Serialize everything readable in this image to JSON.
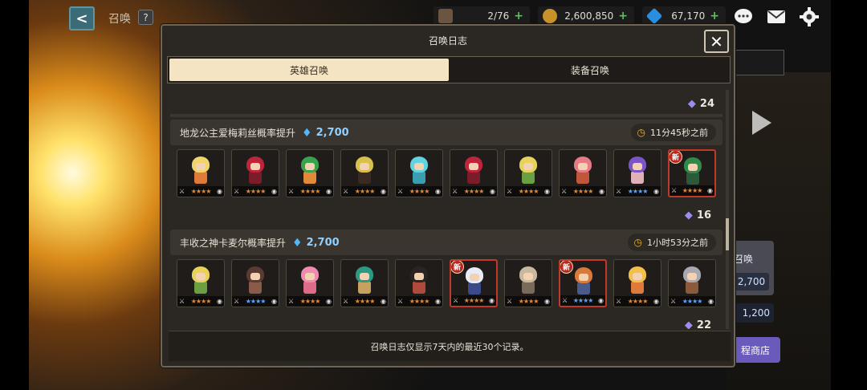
{
  "topbar": {
    "back_label": "<",
    "title": "召唤",
    "help_label": "?",
    "stamina": "2/76",
    "gold": "2,600,850",
    "gems": "67,170",
    "plus": "+"
  },
  "dialog": {
    "title": "召唤日志",
    "close_label": "✕",
    "tabs": [
      {
        "label": "英雄召唤",
        "active": true
      },
      {
        "label": "装备召唤",
        "active": false
      }
    ],
    "footer": "召唤日志仅显示7天内的最近30个记录。"
  },
  "log": {
    "top_count": "24",
    "entries": [
      {
        "title": "地龙公主爱梅莉丝概率提升",
        "cost": "2,700",
        "time": "11分45秒之前",
        "count": "16",
        "heroes": [
          {
            "hair": "#f2d56a",
            "body": "#e07a3a",
            "new": false,
            "stars": "★★★★",
            "blue": false
          },
          {
            "hair": "#c0243a",
            "body": "#7a1c2a",
            "new": false,
            "stars": "★★★★",
            "blue": false
          },
          {
            "hair": "#3aa24a",
            "body": "#e08a3a",
            "new": false,
            "stars": "★★★★",
            "blue": false
          },
          {
            "hair": "#d8c14a",
            "body": "#3b2a22",
            "new": false,
            "stars": "★★★★",
            "blue": false
          },
          {
            "hair": "#5fd3e0",
            "body": "#3a9eb0",
            "new": false,
            "stars": "★★★★",
            "blue": false
          },
          {
            "hair": "#c0243a",
            "body": "#7a1c2a",
            "new": false,
            "stars": "★★★★",
            "blue": false
          },
          {
            "hair": "#e8d25a",
            "body": "#6aa042",
            "new": false,
            "stars": "★★★★",
            "blue": false
          },
          {
            "hair": "#e67a86",
            "body": "#c0563a",
            "new": false,
            "stars": "★★★★",
            "blue": false
          },
          {
            "hair": "#7a55c8",
            "body": "#e0b0b8",
            "new": false,
            "stars": "★★★★",
            "blue": true
          },
          {
            "hair": "#2f8a4a",
            "body": "#2a5a3a",
            "new": true,
            "stars": "★★★★",
            "blue": false
          }
        ]
      },
      {
        "title": "丰收之神卡麦尔概率提升",
        "cost": "2,700",
        "time": "1小时53分之前",
        "count": "22",
        "heroes": [
          {
            "hair": "#e8d25a",
            "body": "#6aa042",
            "new": false,
            "stars": "★★★★",
            "blue": false
          },
          {
            "hair": "#5a3a32",
            "body": "#8a5a4a",
            "new": false,
            "stars": "★★★★",
            "blue": true
          },
          {
            "hair": "#f08ab0",
            "body": "#e06a8a",
            "new": false,
            "stars": "★★★★",
            "blue": false
          },
          {
            "hair": "#2a9a82",
            "body": "#c8a060",
            "new": false,
            "stars": "★★★★",
            "blue": false
          },
          {
            "hair": "#2a2422",
            "body": "#b04a3a",
            "new": false,
            "stars": "★★★★",
            "blue": false
          },
          {
            "hair": "#e8ecf4",
            "body": "#3a4a8a",
            "new": true,
            "stars": "★★★★",
            "blue": false
          },
          {
            "hair": "#c8b8a0",
            "body": "#7a6a5a",
            "new": false,
            "stars": "★★★★",
            "blue": false
          },
          {
            "hair": "#d87a3a",
            "body": "#4a5a8a",
            "new": true,
            "stars": "★★★★",
            "blue": true
          },
          {
            "hair": "#f2c04a",
            "body": "#e07a3a",
            "new": false,
            "stars": "★★★★",
            "blue": false
          },
          {
            "hair": "#a8a8b0",
            "body": "#8a5a3a",
            "new": false,
            "stars": "★★★★",
            "blue": true
          }
        ]
      }
    ],
    "bottom_count": "22"
  },
  "side": {
    "summon_label": "召唤",
    "cost1": "2,700",
    "cost2": "1,200",
    "shop_label": "程商店"
  },
  "new_label": "新"
}
